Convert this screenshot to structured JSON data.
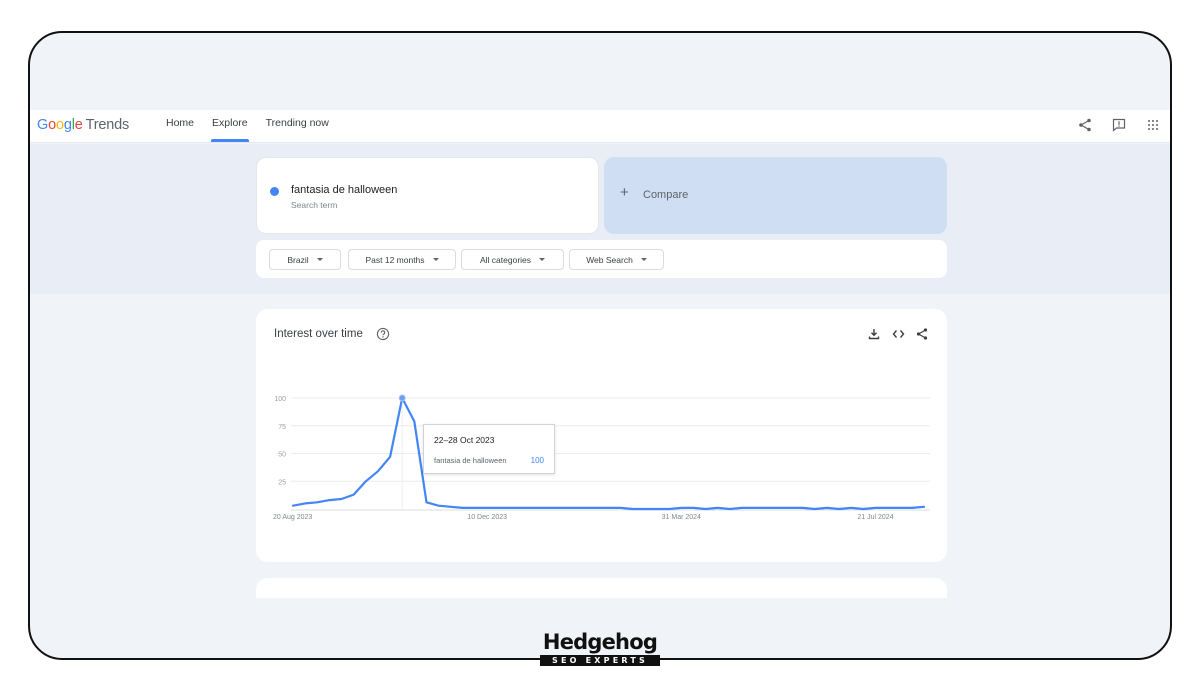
{
  "app": {
    "logo": {
      "google": [
        "G",
        "o",
        "o",
        "g",
        "l",
        "e"
      ],
      "product": "Trends"
    },
    "nav": [
      {
        "label": "Home",
        "active": false
      },
      {
        "label": "Explore",
        "active": true
      },
      {
        "label": "Trending now",
        "active": false
      }
    ],
    "top_icons": [
      "share-icon",
      "feedback-icon",
      "apps-grid-icon"
    ]
  },
  "search": {
    "term": "fantasia de halloween",
    "term_type": "Search term",
    "term_color": "#4285f4",
    "compare_label": "Compare"
  },
  "filters": [
    {
      "label": "Brazil"
    },
    {
      "label": "Past 12 months"
    },
    {
      "label": "All categories"
    },
    {
      "label": "Web Search"
    }
  ],
  "interest_card": {
    "title": "Interest over time",
    "actions": [
      "download-icon",
      "embed-icon",
      "share-icon"
    ],
    "tooltip": {
      "date": "22–28 Oct 2023",
      "term": "fantasia de halloween",
      "value": "100"
    }
  },
  "chart_data": {
    "type": "line",
    "title": "Interest over time",
    "xlabel": "",
    "ylabel": "",
    "ylim": [
      0,
      100
    ],
    "y_ticks": [
      25,
      50,
      75,
      100
    ],
    "x_tick_labels": [
      {
        "label": "20 Aug 2023",
        "index": 0
      },
      {
        "label": "10 Dec 2023",
        "index": 16
      },
      {
        "label": "31 Mar 2024",
        "index": 32
      },
      {
        "label": "21 Jul 2024",
        "index": 48
      }
    ],
    "grid": true,
    "highlight_index": 10,
    "series": [
      {
        "name": "fantasia de halloween",
        "color": "#4285f4",
        "values": [
          3,
          5,
          6,
          8,
          9,
          13,
          25,
          34,
          47,
          100,
          79,
          6,
          3,
          2,
          1,
          1,
          1,
          1,
          1,
          1,
          1,
          1,
          1,
          1,
          1,
          1,
          1,
          1,
          0,
          0,
          0,
          0,
          1,
          1,
          0,
          1,
          0,
          1,
          1,
          1,
          1,
          1,
          1,
          0,
          1,
          0,
          1,
          0,
          1,
          1,
          1,
          1,
          2
        ]
      }
    ]
  },
  "watermark": {
    "name": "Hedgehog",
    "tagline": "SEO EXPERTS"
  }
}
